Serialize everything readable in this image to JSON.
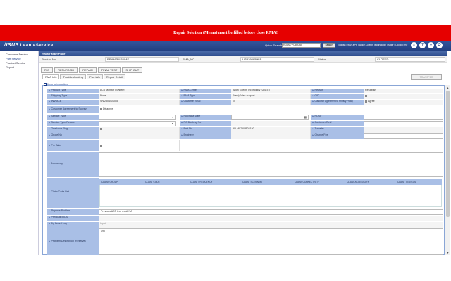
{
  "alert": "Repair Solution (Memo) must be filled before close RMA!",
  "header": {
    "logo": "/ISUS",
    "app_name": "Lean eService",
    "quick_search_label": "Quick Search",
    "quick_search_value": "RDLM7PU6604E",
    "search_button": "Search",
    "links": "English | wsh-ePF | Allion Giiech Technology | Agiltr | Local Time"
  },
  "sidebar": {
    "items": [
      "Customer Service",
      "Part Service",
      "Product Service",
      "Report"
    ]
  },
  "page_title": "Repair Main Page",
  "info_bar": {
    "product_no_label": "Product No",
    "product_no": "RRAM7PU6604E",
    "rma_no_label": "RMA_NO",
    "rma_no": "USB29485HLR",
    "status_label": "Status",
    "status": "CLOSED"
  },
  "main_tabs": [
    "RIG",
    "REFURBISH",
    "REPAIR",
    "FINAL TEST",
    "SHIP OUT"
  ],
  "sub_tabs": [
    "RMA Info",
    "Troubleshooting",
    "Part info",
    "Repair Detail"
  ],
  "transfer_button": "TRANSFER",
  "section_title": "Item Information",
  "rows": {
    "product_type": {
      "label": "Product Type",
      "value": "LCD Monitor (System)"
    },
    "rma_center": {
      "label": "RMA Center",
      "value": "Allion Gitech Technology (USEC)"
    },
    "reason": {
      "label": "Reason",
      "value": "Refurbish"
    },
    "shipping_type": {
      "label": "Shipping Type",
      "value": "None"
    },
    "rma_type": {
      "label": "RMA Type",
      "value": "(New)Sales support"
    },
    "cid": {
      "label": "CID",
      "value": ""
    },
    "invoice": {
      "label": "INVOICE",
      "value": "SN 2504/1/10/5"
    },
    "customer_ssn": {
      "label": "Customer SSN",
      "value": "N"
    },
    "privacy": {
      "label": "Customer Agreement to Privacy Policy",
      "value": "Agree"
    },
    "survey": {
      "label": "Customer Agreement to Survey",
      "value": "Disagree"
    },
    "service_type": {
      "label": "Service Type",
      "value": ""
    },
    "purchase_date": {
      "label": "Purchase Date",
      "value": ""
    },
    "pos": {
      "label": "POS#",
      "value": ""
    },
    "service_type_reason": {
      "label": "Service Type Reason",
      "value": ""
    },
    "rc_booking": {
      "label": "RC Booking No",
      "value": ""
    },
    "customer_ref": {
      "label": "Customer Ref#",
      "value": ""
    },
    "one_hour": {
      "label": "One Hour Flag",
      "value": ""
    },
    "part_no": {
      "label": "Part No",
      "value": "90LM0750-B02150"
    },
    "transfer": {
      "label": "Transfer",
      "value": ""
    },
    "quote_no": {
      "label": "Quote No",
      "value": ""
    },
    "engineer": {
      "label": "Engineer",
      "value": ""
    },
    "charge_fee": {
      "label": "Charge Fee",
      "value": ""
    },
    "pre_sale": {
      "label": "Pre Sale",
      "value": ""
    },
    "accessory": {
      "label": "Accessory",
      "value": ""
    },
    "claim_code": {
      "label": "Claim Code List",
      "value": ""
    },
    "replace_problem": {
      "label": "Replace Problem",
      "value": "Previous ADT test result NA"
    },
    "previous_bios": {
      "label": "Previous BIOS",
      "value": ""
    },
    "jig_board": {
      "label": "Jig Board Log",
      "value": "Input"
    },
    "problem_desc": {
      "label": "Problem Description (Reserve)",
      "value": "190"
    }
  },
  "claim_columns": [
    "CLAIM_GROUP",
    "CLAIM_CODE",
    "CLAIM_FREQUENCY",
    "CLAIM_SCENARIO",
    "CLAIM_CONNECTIVITY",
    "CLAIM_ACCESSORY",
    "CLAIM_TELECOM"
  ]
}
